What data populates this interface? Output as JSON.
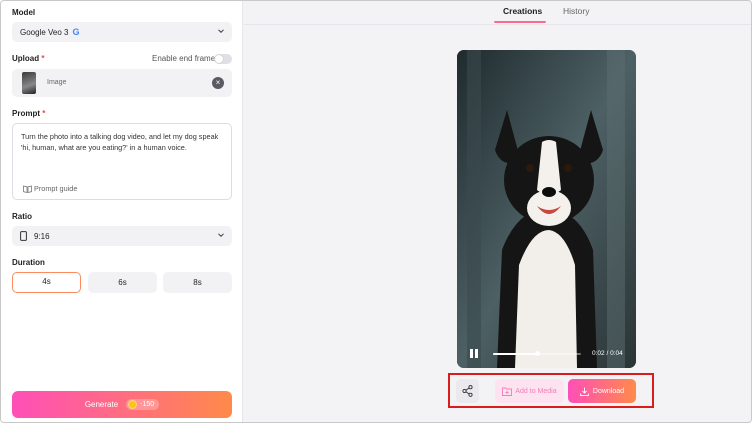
{
  "model": {
    "label": "Model",
    "selected": "Google Veo 3",
    "provider_icon": "google-g-icon"
  },
  "upload": {
    "label": "Upload",
    "required_mark": "*",
    "end_frame_label": "Enable end frame",
    "file_name": "Image"
  },
  "prompt": {
    "label": "Prompt",
    "required_mark": "*",
    "value": "Turn the photo into a talking dog video, and let my dog speak 'hi, human, what are you eating?' in a human voice.",
    "guide_label": "Prompt guide"
  },
  "ratio": {
    "label": "Ratio",
    "selected": "9:16"
  },
  "duration": {
    "label": "Duration",
    "options": [
      "4s",
      "6s",
      "8s"
    ],
    "selected": "4s"
  },
  "generate": {
    "label": "Generate",
    "cost": "-150"
  },
  "tabs": {
    "creations": "Creations",
    "history": "History",
    "active": "Creations"
  },
  "player": {
    "time": "0:02 / 0:04",
    "progress": 0.5
  },
  "actions": {
    "add_to_media": "Add to Media",
    "download": "Download"
  },
  "colors": {
    "accent_start": "#ff4fb8",
    "accent_end": "#ff8a4a",
    "highlight_border": "#d91c1c"
  }
}
